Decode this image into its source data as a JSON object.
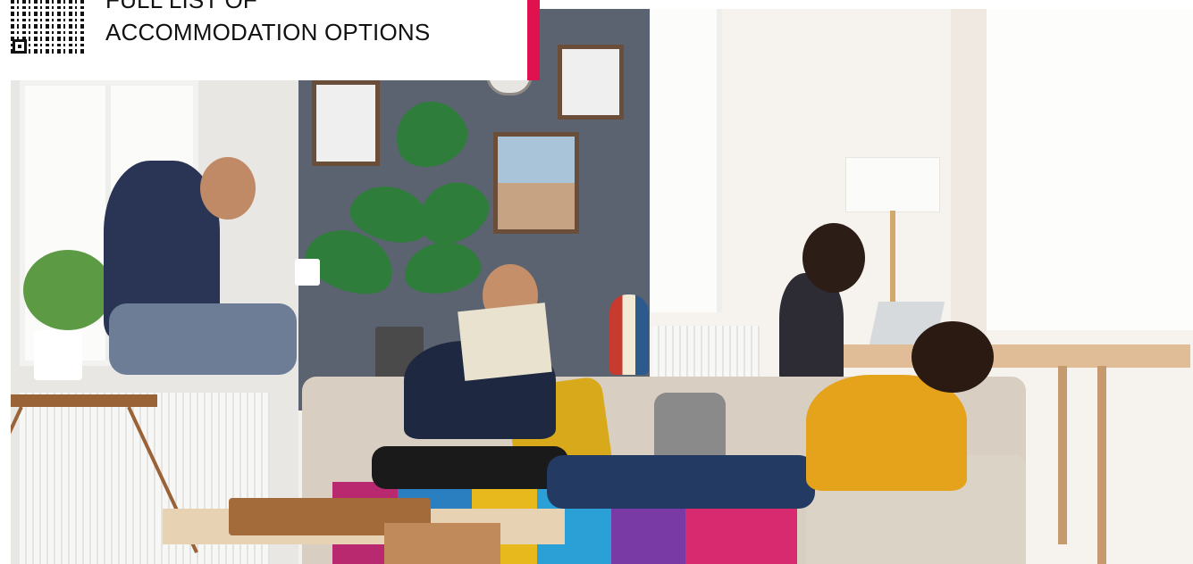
{
  "header": {
    "line1": "FULL LIST OF",
    "line2": "ACCOMMODATION OPTIONS"
  },
  "qr_code": {
    "icon": "qr-code-icon"
  },
  "colors": {
    "accent": "#e0114f",
    "text": "#111111"
  },
  "photo": {
    "subject": "",
    "content": ""
  }
}
